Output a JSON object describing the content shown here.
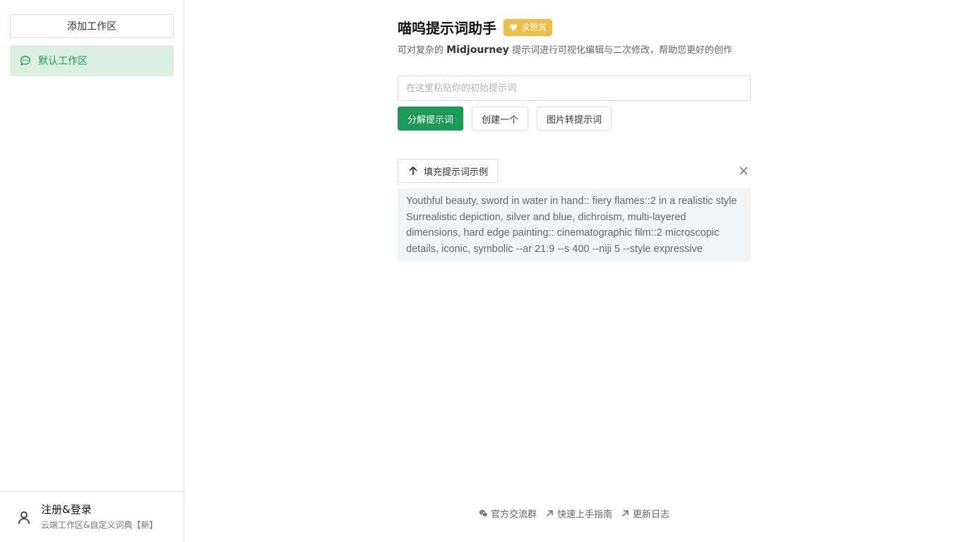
{
  "sidebar": {
    "add_workspace_label": "添加工作区",
    "workspaces": [
      {
        "label": "默认工作区",
        "icon": "chat-bubble-icon",
        "active": true
      }
    ],
    "account": {
      "title": "注册&登录",
      "subtitle": "云端工作区&自定义词典【新】",
      "icon": "user-icon"
    }
  },
  "header": {
    "title": "喵呜提示词助手",
    "badge": "求赞赏",
    "subtitle_before": "可对复杂的",
    "subtitle_brand": "Midjourney",
    "subtitle_after": "提示词进行可视化编辑与二次修改，帮助您更好的创作"
  },
  "prompt": {
    "placeholder": "在这里粘贴你的初始提示词",
    "value": ""
  },
  "actions": {
    "decompose": "分解提示词",
    "create": "创建一个",
    "image_to_prompt": "图片转提示词"
  },
  "example": {
    "fill_label": "填充提示词示例",
    "text": "Youthful beauty, sword in water in hand:: fiery flames::2 in a realistic style Surrealistic depiction, silver and blue, dichroism, multi-layered dimensions, hard edge painting:: cinematographic film::2 microscopic details, iconic, symbolic --ar 21:9 --s 400 --niji 5 --style expressive"
  },
  "footer": {
    "links": [
      {
        "label": "官方交流群",
        "icon": "wechat-icon"
      },
      {
        "label": "快速上手指南",
        "icon": "external-arrow-icon"
      },
      {
        "label": "更新日志",
        "icon": "external-arrow-icon"
      }
    ]
  },
  "colors": {
    "accent": "#1a9a55",
    "accent_light": "#dcf0e2",
    "badge": "#f0bd45"
  }
}
